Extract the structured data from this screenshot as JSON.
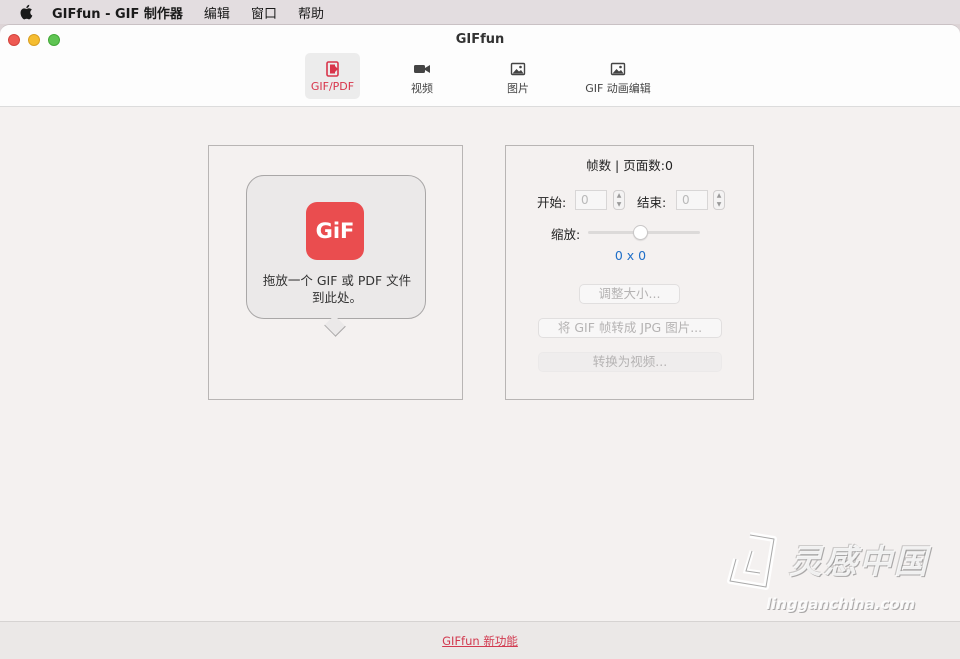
{
  "menubar": {
    "app_name": "GIFfun - GIF 制作器",
    "items": [
      {
        "label": "编辑"
      },
      {
        "label": "窗口"
      },
      {
        "label": "帮助"
      }
    ]
  },
  "window": {
    "title": "GIFfun"
  },
  "toolbar": {
    "tabs": [
      {
        "label": "GIF/PDF",
        "icon": "gif-pdf-icon",
        "active": true
      },
      {
        "label": "视频",
        "icon": "video-camera-icon",
        "active": false
      },
      {
        "label": "图片",
        "icon": "image-icon",
        "active": false
      },
      {
        "label": "GIF 动画编辑",
        "icon": "image-icon",
        "active": false
      }
    ]
  },
  "drop_zone": {
    "logo_text": "GiF",
    "hint_text": "拖放一个 GIF 或 PDF 文件到此处。"
  },
  "settings": {
    "heading": "帧数 | 页面数:0",
    "start_label": "开始:",
    "start_value": "0",
    "end_label": "结束:",
    "end_value": "0",
    "scale_label": "缩放:",
    "scale_value": 0.5,
    "size_readout": "0 x 0",
    "resize_button": "调整大小...",
    "convert_jpg_button": "将 GIF 帧转成 JPG 图片...",
    "convert_video_button": "转换为视频..."
  },
  "footer": {
    "new_features_link": "GIFfun 新功能"
  },
  "watermark": {
    "title": "灵感中国",
    "url": "lingganchina.com"
  },
  "colors": {
    "accent": "#d8344a",
    "logo": "#ea4d4f",
    "link_blue": "#1f6fc8"
  }
}
